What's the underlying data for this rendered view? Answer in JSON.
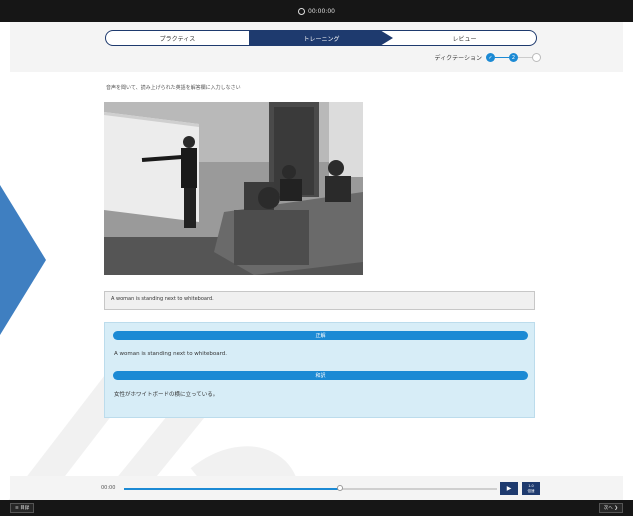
{
  "topbar": {
    "timer": "00:00:00"
  },
  "tabs": [
    {
      "label": "プラクティス"
    },
    {
      "label": "トレーニング"
    },
    {
      "label": "レビュー"
    }
  ],
  "steps": {
    "label": "ディクテーション",
    "current": "2"
  },
  "instruction": "音声を聞いて、読み上げられた英語を解答欄に入力しなさい",
  "answer": {
    "value": "A woman is standing next to whiteboard."
  },
  "result": {
    "correct_heading": "正解",
    "correct_text": "A woman is standing next to whiteboard.",
    "translation_heading": "和訳",
    "translation_text": "女性がホワイトボードの横に立っている。"
  },
  "player": {
    "time": "00:00",
    "progress": 0.58,
    "play_icon": "▶",
    "speed_value": "1.0",
    "speed_label": "倍速"
  },
  "footer": {
    "left_button": "≡ 目録",
    "right_button": "次へ ❯"
  }
}
